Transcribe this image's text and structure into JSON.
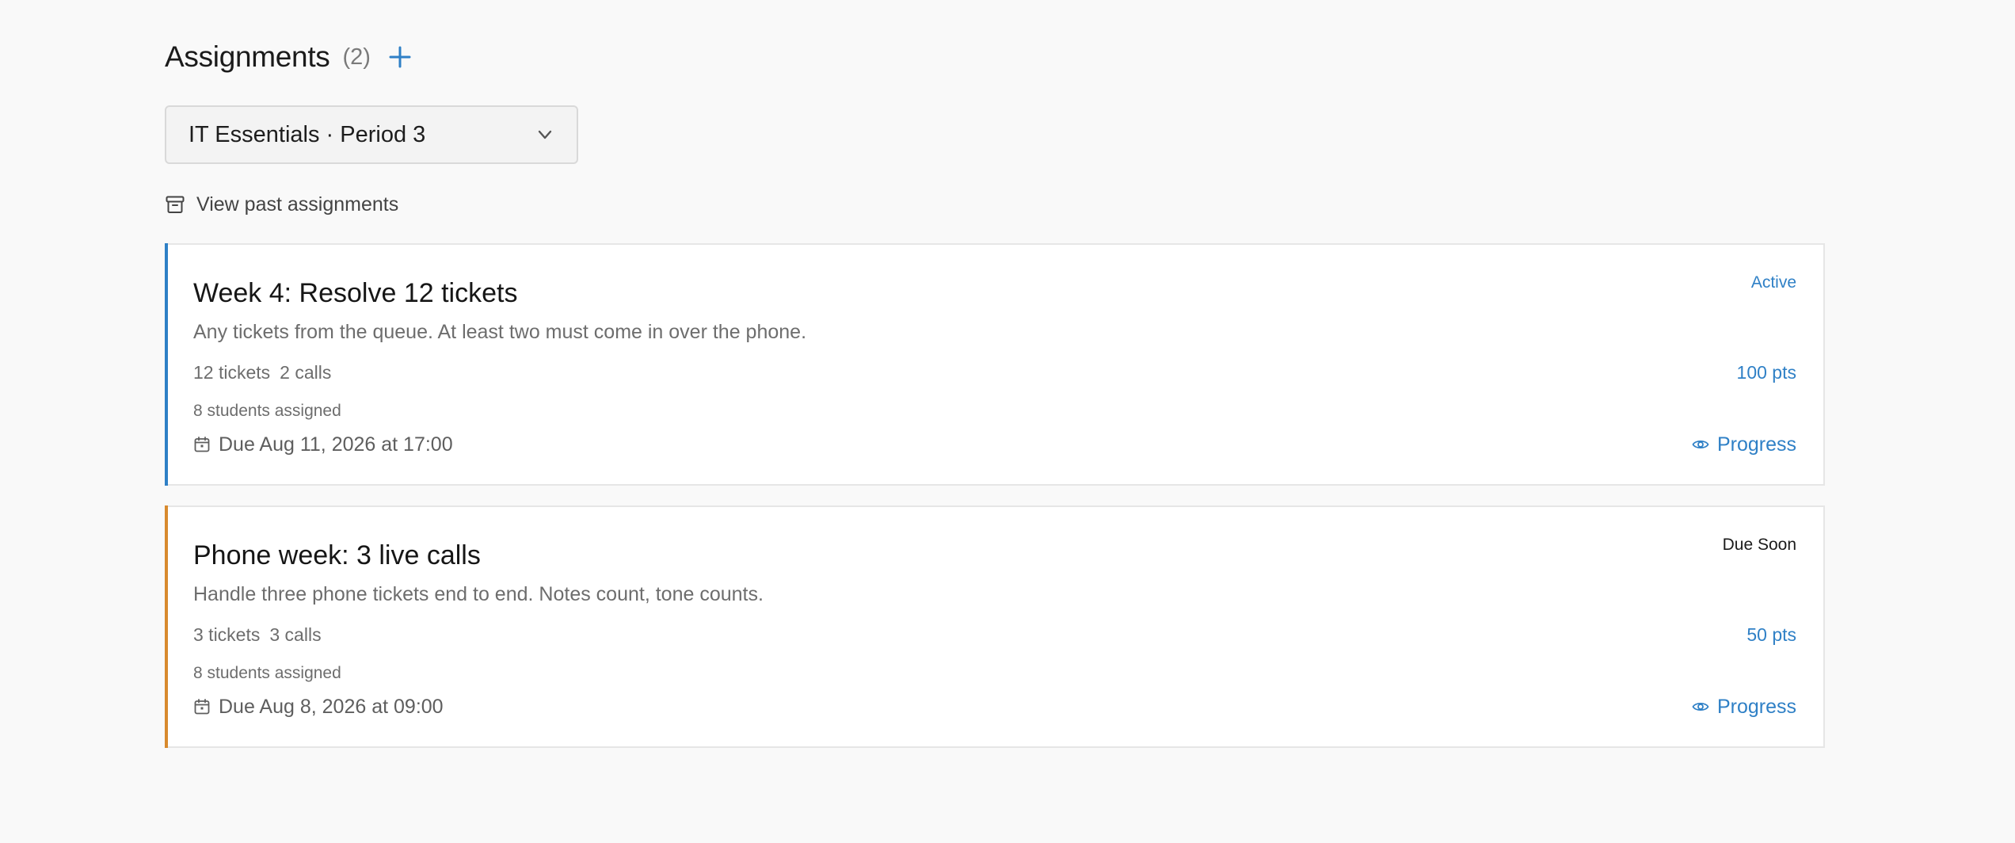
{
  "header": {
    "title": "Assignments",
    "count": "(2)"
  },
  "class_select": {
    "value": "IT Essentials · Period 3"
  },
  "past_link": {
    "label": "View past assignments"
  },
  "colors": {
    "accent": "#2f80c6",
    "active_accent": "#2f80c6",
    "due_soon_accent": "#d88a2e"
  },
  "assignments": [
    {
      "title": "Week 4: Resolve 12 tickets",
      "description": "Any tickets from the queue. At least two must come in over the phone.",
      "tickets": "12 tickets",
      "calls": "2 calls",
      "assigned": "8 students assigned",
      "due": "Due Aug 11, 2026 at 17:00",
      "status": "Active",
      "points": "100 pts",
      "progress_label": "Progress"
    },
    {
      "title": "Phone week: 3 live calls",
      "description": "Handle three phone tickets end to end. Notes count, tone counts.",
      "tickets": "3 tickets",
      "calls": "3 calls",
      "assigned": "8 students assigned",
      "due": "Due Aug 8, 2026 at 09:00",
      "status": "Due Soon",
      "points": "50 pts",
      "progress_label": "Progress"
    }
  ]
}
